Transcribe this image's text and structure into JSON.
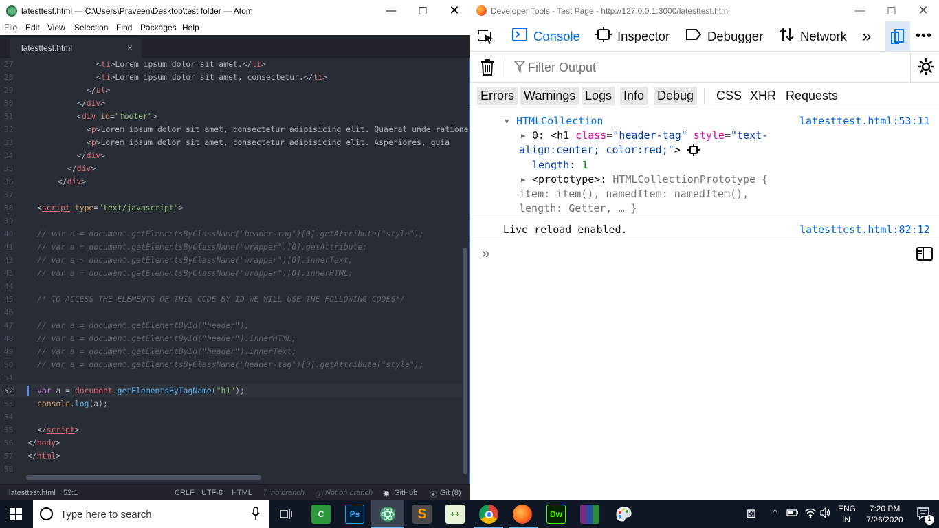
{
  "atom": {
    "window_title": "latesttest.html — C:\\Users\\Praveen\\Desktop\\test folder — Atom",
    "menu": [
      "File",
      "Edit",
      "View",
      "Selection",
      "Find",
      "Packages",
      "Help"
    ],
    "tab_label": "latesttest.html",
    "tab_close": "×",
    "line_numbers": [
      "27",
      "28",
      "29",
      "30",
      "31",
      "32",
      "33",
      "34",
      "35",
      "36",
      "37",
      "38",
      "39",
      "40",
      "41",
      "42",
      "43",
      "44",
      "45",
      "46",
      "47",
      "48",
      "49",
      "50",
      "51",
      "52",
      "53",
      "54",
      "55",
      "56",
      "57",
      "58"
    ],
    "code": {
      "l27a": "<",
      "l27b": "li",
      "l27c": ">Lorem ipsum dolor sit amet.</",
      "l27d": "li",
      "l27e": ">",
      "l28a": "<",
      "l28b": "li",
      "l28c": ">Lorem ipsum dolor sit amet, consectetur.</",
      "l28d": "li",
      "l28e": ">",
      "l29a": "</",
      "l29b": "ul",
      "l29c": ">",
      "l30a": "</",
      "l30b": "div",
      "l30c": ">",
      "l31a": "<",
      "l31b": "div",
      "l31c": " ",
      "l31d": "id",
      "l31e": "=",
      "l31f": "\"footer\"",
      "l31g": ">",
      "l32a": "<",
      "l32b": "p",
      "l32c": ">Lorem ipsum dolor sit amet, consectetur adipisicing elit. Quaerat unde ratione",
      "l33a": "<",
      "l33b": "p",
      "l33c": ">Lorem ipsum dolor sit amet, consectetur adipisicing elit. Asperiores, quia",
      "l34a": "</",
      "l34b": "div",
      "l34c": ">",
      "l35a": "</",
      "l35b": "div",
      "l35c": ">",
      "l36a": "</",
      "l36b": "div",
      "l36c": ">",
      "l38a": "<",
      "l38b": "script",
      "l38c": " ",
      "l38d": "type",
      "l38e": "=",
      "l38f": "\"text/javascript\"",
      "l38g": ">",
      "l40": "// var a = document.getElementsByClassName(\"header-tag\")[0].getAttribute(\"style\");",
      "l41": "// var a = document.getElementsByClassName(\"wrapper\")[0].getAttribute;",
      "l42": "// var a = document.getElementsByClassName(\"wrapper\")[0].innerText;",
      "l43": "// var a = document.getElementsByClassName(\"wrapper\")[0].innerHTML;",
      "l45": "/* TO ACCESS THE ELEMENTS OF THIS CODE BY ID WE WILL USE THE FOLLOWING CODES*/",
      "l47": "// var a = document.getElementById(\"header\");",
      "l48": "// var a = document.getElementById(\"header\").innerHTML;",
      "l49": "// var a = document.getElementById(\"header\").innerText;",
      "l50": "// var a = document.getElementsByClassName(\"header-tag\")[0].getAttribute(\"style\");",
      "l52a": "var",
      "l52b": " a ",
      "l52c": "=",
      "l52d": " document",
      "l52e": ".",
      "l52f": "getElementsByTagName",
      "l52g": "(",
      "l52h": "\"h1\"",
      "l52i": ");",
      "l53a": "console",
      "l53b": ".",
      "l53c": "log",
      "l53d": "(a);",
      "l55a": "</",
      "l55b": "script",
      "l55c": ">",
      "l56a": "</",
      "l56b": "body",
      "l56c": ">",
      "l57a": "</",
      "l57b": "html",
      "l57c": ">"
    },
    "status": {
      "file": "latesttest.html",
      "cursor": "52:1",
      "eol": "CRLF",
      "encoding": "UTF-8",
      "grammar": "HTML",
      "branch": "no branch",
      "not_on_branch": "Not on branch",
      "github": "GitHub",
      "git": "Git (8)"
    }
  },
  "devtools": {
    "window_title": "Developer Tools - Test Page - http://127.0.0.1:3000/latesttest.html",
    "tabs": [
      "Console",
      "Inspector",
      "Debugger",
      "Network"
    ],
    "filter_placeholder": "Filter Output",
    "categories_toggled": [
      "Errors",
      "Warnings",
      "Logs",
      "Info",
      "Debug"
    ],
    "categories_plain": [
      "CSS",
      "XHR",
      "Requests"
    ],
    "log1": {
      "title": "HTMLCollection",
      "source": "latesttest.html:53:11",
      "item_index": "0:",
      "item_open": "<h1",
      "attr_class": "class",
      "attr_eq": "=",
      "attr_class_val": "\"header-tag\"",
      "attr_style": "style",
      "attr_style_val_1": "\"text-",
      "attr_style_val_2": "align:center; color:red;\"",
      "item_close": ">",
      "length_key": "length",
      "length_sep": ":",
      "length_val": "1",
      "proto_key": "<prototype>",
      "proto_sep": ":",
      "proto_val_1": "HTMLCollectionPrototype {",
      "proto_val_2": "item: item(), namedItem: namedItem(),",
      "proto_val_3": "length: Getter, … }"
    },
    "log2": {
      "message": "Live reload enabled.",
      "source": "latesttest.html:82:12"
    }
  },
  "taskbar": {
    "search_placeholder": "Type here to search",
    "lang_1": "ENG",
    "lang_2": "IN",
    "time": "7:20 PM",
    "date": "7/26/2020",
    "notification_count": "1",
    "apps": [
      "Task View",
      "Camtasia",
      "Photoshop",
      "Atom",
      "Sublime Text",
      "Notepad++",
      "Chrome",
      "Firefox",
      "Dreamweaver",
      "WinRAR",
      "Paint"
    ]
  },
  "colors": {
    "atom_bg": "#282c34",
    "devtools_accent": "#0074e8",
    "taskbar_bg": "#0f1724"
  }
}
